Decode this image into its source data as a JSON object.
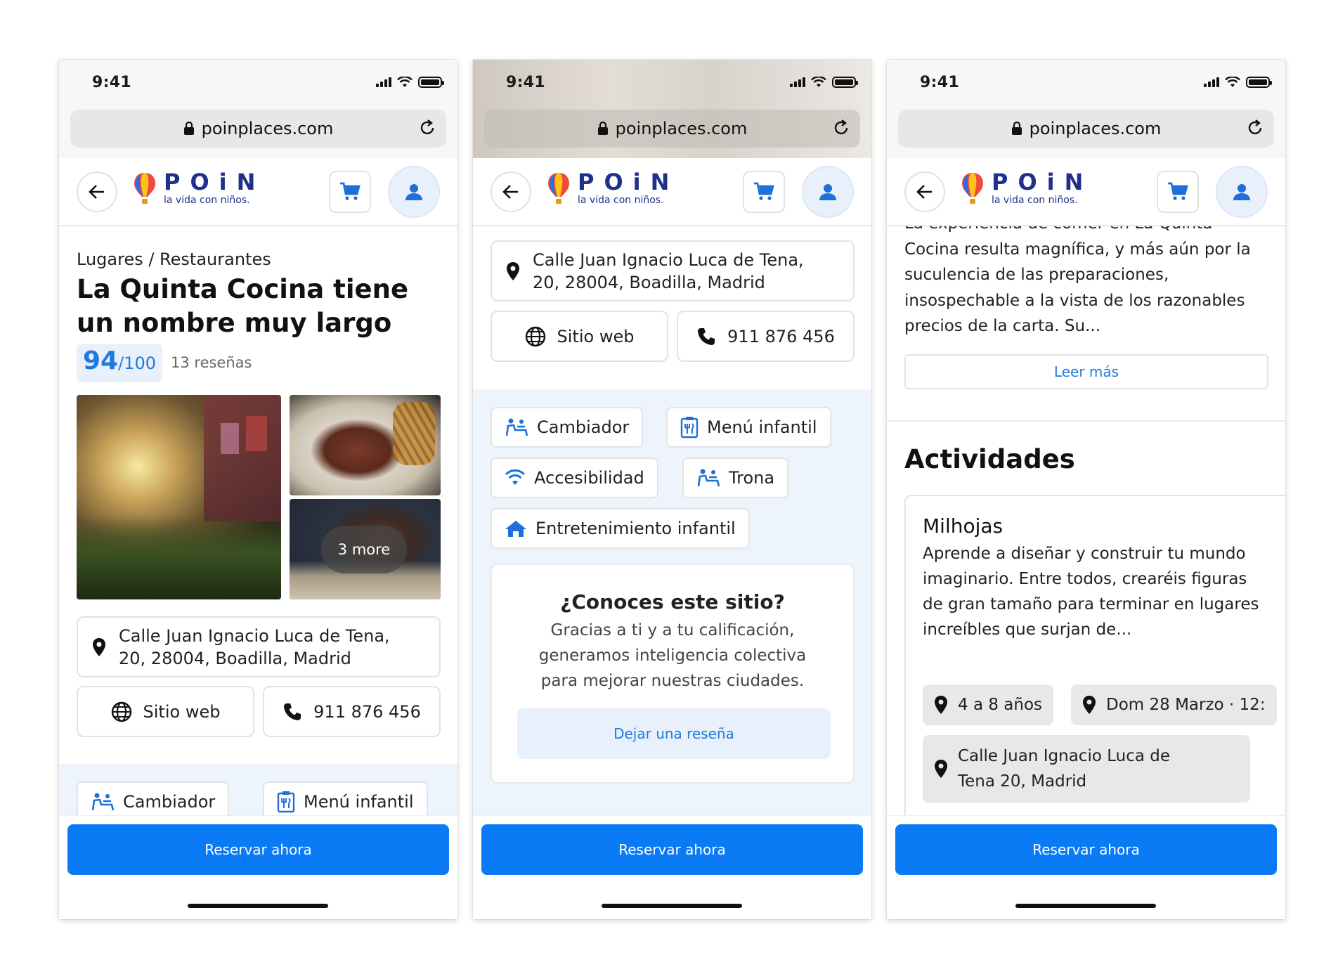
{
  "status": {
    "time": "9:41"
  },
  "browser": {
    "url": "poinplaces.com"
  },
  "brand": {
    "name": "POiN",
    "tagline": "la vida con niños."
  },
  "place": {
    "breadcrumb": "Lugares / Restaurantes",
    "title": "La Quinta Cocina tiene un nombre muy largo",
    "score": "94",
    "score_max": "/100",
    "reviews": "13 reseñas",
    "more_photos": "3 more",
    "address_line1": "Calle Juan Ignacio Luca de Tena,",
    "address_line2": "20, 28004, Boadilla, Madrid",
    "website_label": "Sitio web",
    "phone_label": "911 876 456"
  },
  "amenities": {
    "changer": "Cambiador",
    "kids_menu": "Menú infantil",
    "accessibility": "Accesibilidad",
    "high_chair": "Trona",
    "entertainment": "Entretenimiento infantil"
  },
  "know": {
    "title": "¿Conoces este sitio?",
    "body": "Gracias a ti y a tu calificación, generamos inteligencia colectiva para mejorar nuestras ciudades.",
    "button": "Dejar una reseña"
  },
  "description": {
    "first_line": "La experiencia de comer en La Quinta",
    "text": "Cocina resulta magnífica, y más aún por la suculencia de las preparaciones, insospechable a la vista de los razonables precios de la carta. Su...",
    "read_more": "Leer más"
  },
  "activities": {
    "heading": "Actividades",
    "item": {
      "title": "Milhojas",
      "body": "Aprende a diseñar y construir tu mundo imaginario. Entre todos, crearéis figuras de gran tamaño para terminar en lugares increíbles que surjan de...",
      "ages": "4 a 8 años",
      "date": "Dom 28 Marzo · 12:",
      "address_line1": "Calle Juan Ignacio Luca de",
      "address_line2": "Tena 20, Madrid"
    }
  },
  "cta": {
    "label": "Reservar ahora"
  },
  "colors": {
    "primary": "#0b7bf5",
    "brand_navy": "#1f2f8c",
    "tint": "#e8f0fb",
    "amenity_bg": "#eef4fc"
  },
  "icons": [
    "lock-icon",
    "reload-icon",
    "back-arrow-icon",
    "cart-icon",
    "user-icon",
    "location-pin-icon",
    "globe-icon",
    "phone-icon",
    "baby-changer-icon",
    "kids-menu-icon",
    "wifi-icon",
    "home-icon",
    "balloon-logo-icon"
  ]
}
